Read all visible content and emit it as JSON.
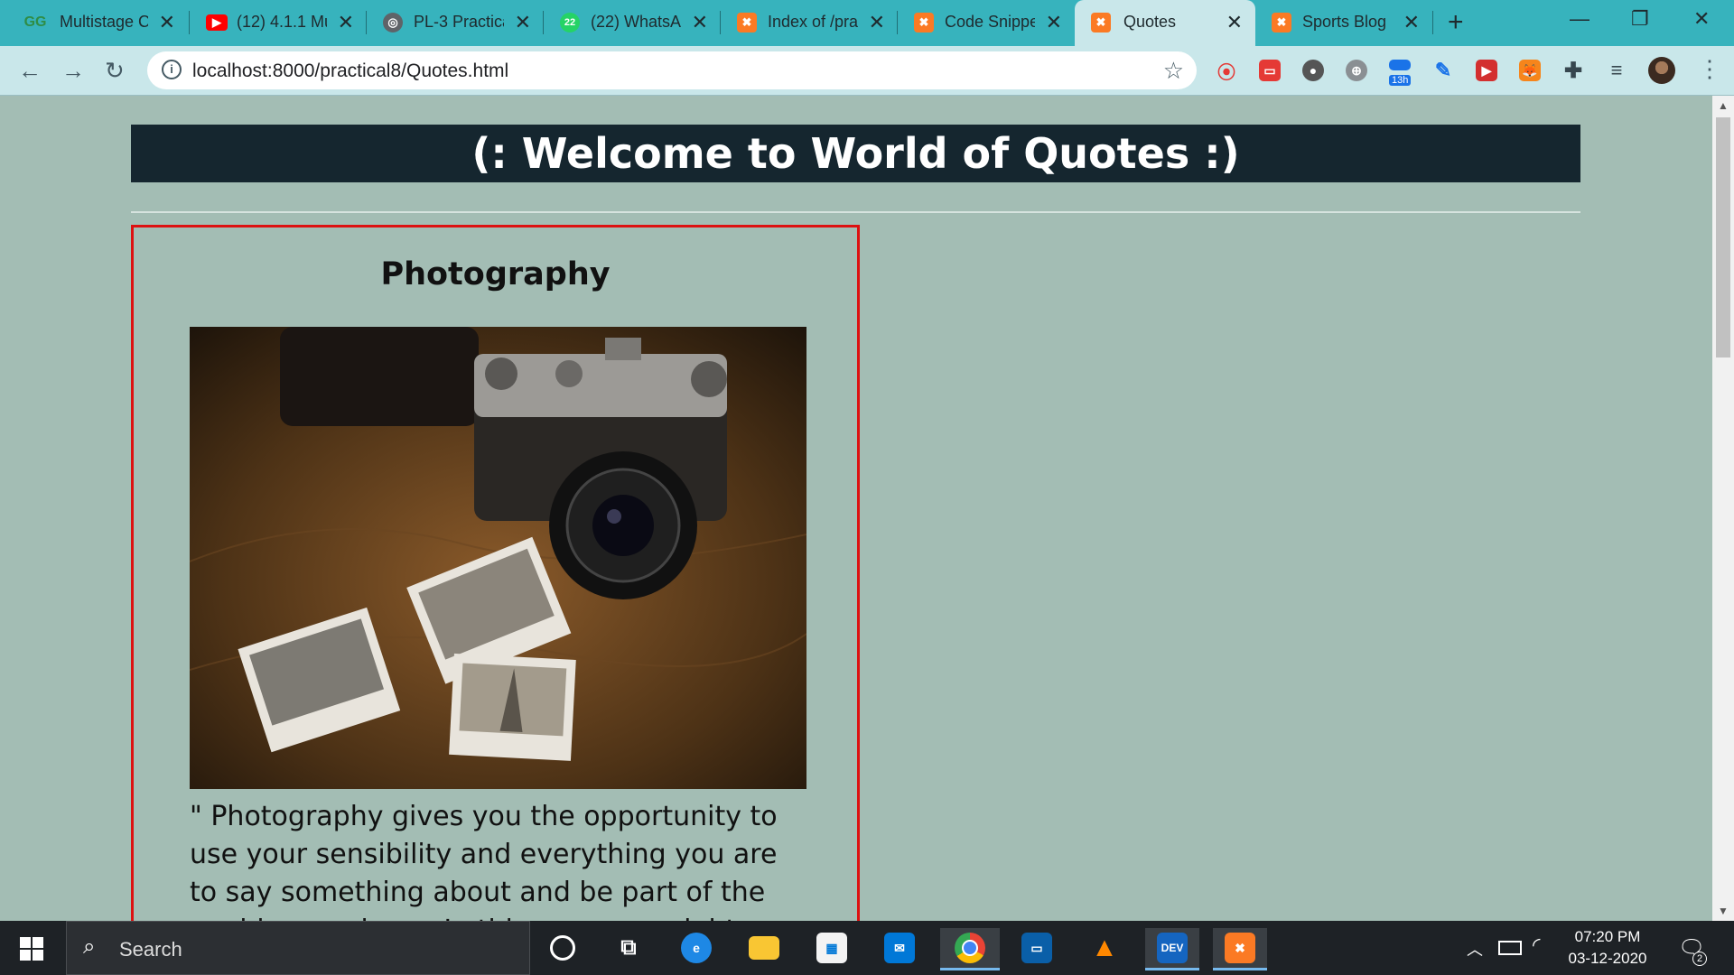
{
  "browser": {
    "tabs": [
      {
        "label": "Multistage C",
        "icon": "geeksforgeeks-icon",
        "active": false
      },
      {
        "label": "(12) 4.1.1 Mu",
        "icon": "youtube-icon",
        "active": false
      },
      {
        "label": "PL-3 Practica",
        "icon": "globe-icon",
        "active": false
      },
      {
        "label": "(22) WhatsA",
        "icon": "whatsapp-icon",
        "active": false
      },
      {
        "label": "Index of /pra",
        "icon": "xampp-icon",
        "active": false
      },
      {
        "label": "Code Snippe",
        "icon": "xampp-icon",
        "active": false
      },
      {
        "label": "Quotes",
        "icon": "xampp-icon",
        "active": true
      },
      {
        "label": "Sports Blog",
        "icon": "xampp-icon",
        "active": false
      }
    ],
    "url": "localhost:8000/practical8/Quotes.html",
    "ext_badge": "13h",
    "whatsapp_badge": "22"
  },
  "page": {
    "banner": "(: Welcome to World of Quotes :)",
    "card_title": "Photography",
    "quote": "\" Photography gives you the opportunity to use your sensibility and everything you are to say something about and be part of the world around you. In this way you might discover who"
  },
  "taskbar": {
    "search_placeholder": "Search",
    "time": "07:20 PM",
    "date": "03-12-2020",
    "notification_count": "2"
  },
  "colors": {
    "tab_strip": "#37b3bd",
    "toolbar": "#c9e7ea",
    "page_bg": "#a3bdb4",
    "banner_bg": "#15262f",
    "card_border": "#dd1111"
  }
}
